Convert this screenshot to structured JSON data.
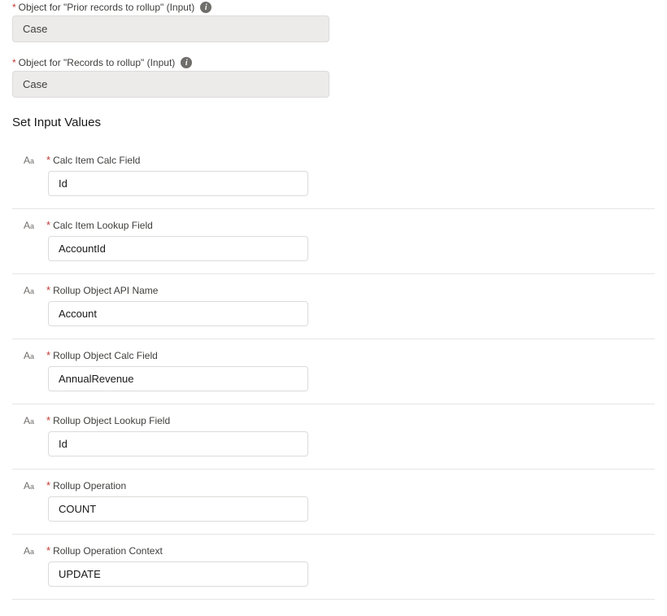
{
  "topFields": {
    "priorRecords": {
      "label": "Object for \"Prior records to rollup\" (Input)",
      "value": "Case"
    },
    "recordsToRollup": {
      "label": "Object for \"Records to rollup\" (Input)",
      "value": "Case"
    }
  },
  "sectionTitle": "Set Input Values",
  "inputs": {
    "calcItemCalcField": {
      "label": "Calc Item Calc Field",
      "value": "Id"
    },
    "calcItemLookupField": {
      "label": "Calc Item Lookup Field",
      "value": "AccountId"
    },
    "rollupObjectApiName": {
      "label": "Rollup Object API Name",
      "value": "Account"
    },
    "rollupObjectCalcField": {
      "label": "Rollup Object Calc Field",
      "value": "AnnualRevenue"
    },
    "rollupObjectLookupField": {
      "label": "Rollup Object Lookup Field",
      "value": "Id"
    },
    "rollupOperation": {
      "label": "Rollup Operation",
      "value": "COUNT"
    },
    "rollupOperationContext": {
      "label": "Rollup Operation Context",
      "value": "UPDATE"
    }
  }
}
